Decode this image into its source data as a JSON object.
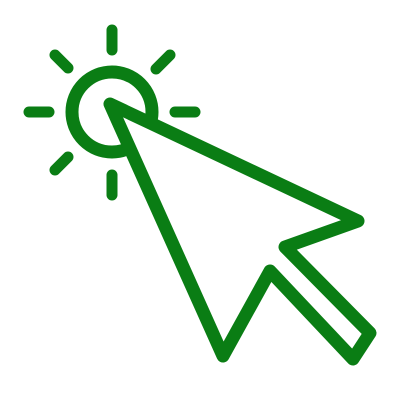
{
  "icon": {
    "name": "click-cursor-icon",
    "description_visible_text": "",
    "stroke_color": "#0a7d14",
    "background_color": "#ffffff"
  }
}
